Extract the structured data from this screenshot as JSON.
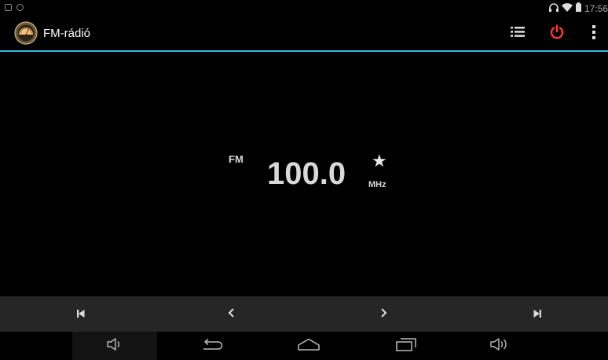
{
  "status_bar": {
    "time": "17:56",
    "icons": [
      "screenshot-icon",
      "notification-icon",
      "headphones-icon",
      "wifi-icon",
      "battery-icon"
    ]
  },
  "action_bar": {
    "title": "FM-rádió",
    "icons": [
      "radio-app-icon",
      "station-list-icon",
      "power-icon",
      "overflow-menu-icon"
    ],
    "power_color": "#ff3b30",
    "divider_color": "#33b5e5"
  },
  "tuner": {
    "band": "FM",
    "frequency": "100.0",
    "unit": "MHz",
    "favorite_icon": "star-icon"
  },
  "controls": {
    "icons": [
      "seek-previous-icon",
      "step-back-icon",
      "step-forward-icon",
      "seek-next-icon"
    ]
  },
  "nav_bar": {
    "icons": [
      "volume-down-icon",
      "back-icon",
      "home-icon",
      "recents-icon",
      "volume-up-icon"
    ]
  }
}
